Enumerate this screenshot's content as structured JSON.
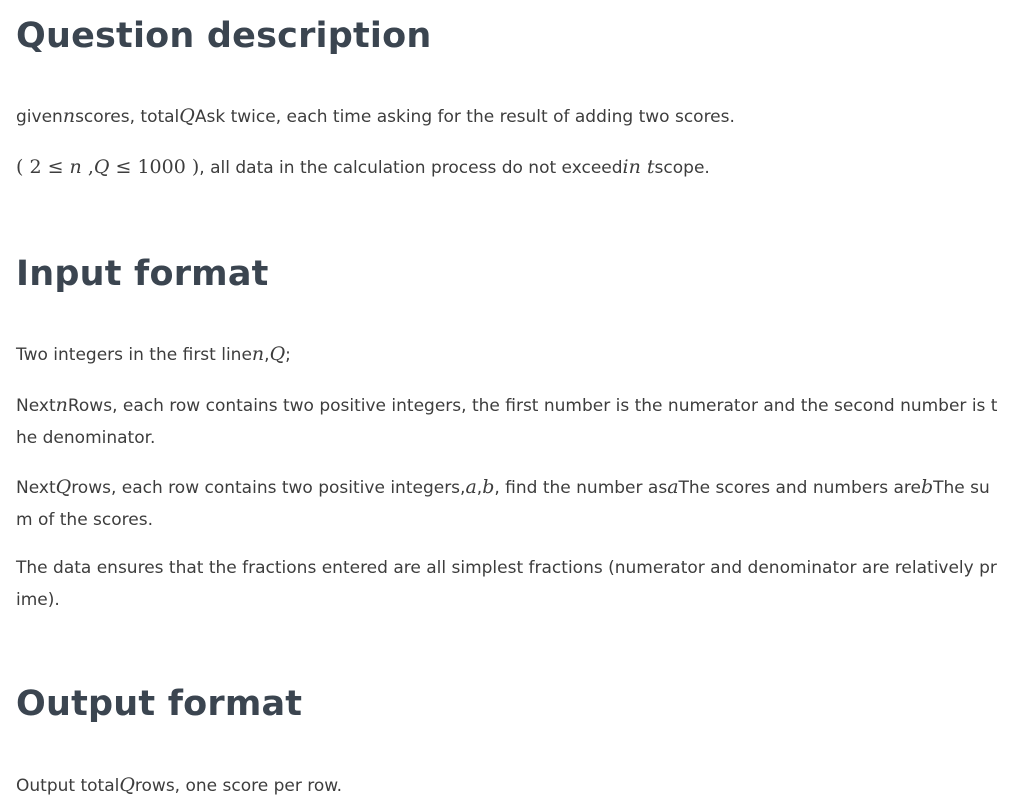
{
  "sections": {
    "description": {
      "heading": "Question description",
      "p1": {
        "t1": "given",
        "v_n": "n",
        "t2": "scores, total",
        "v_Q": "Q",
        "t3": "Ask twice, each time asking for the result of adding two scores."
      },
      "p2": {
        "open": "( ",
        "c2": "2",
        "le1": " ≤ ",
        "v_n": "n",
        "comma": " ,",
        "v_Q": "Q",
        "le2": " ≤ ",
        "c1000": "1000",
        "close": " )",
        "t1": ", all data in the calculation process do not exceed",
        "v_in": "in",
        "v_t": " t",
        "t2": "scope."
      }
    },
    "input": {
      "heading": "Input format",
      "p1": {
        "t1": "Two integers in the first line",
        "v_n": "n",
        "sep": ",",
        "v_Q": "Q",
        "t2": ";"
      },
      "p2": {
        "t1": "Next",
        "v_n": "n",
        "t2": "Rows, each row contains two positive integers, the first number is the numerator and the second number is the denominator."
      },
      "p3": {
        "t1": "Next",
        "v_Q": "Q",
        "t2": "rows, each row contains two positive integers,",
        "v_a": "a",
        "sep": ",",
        "v_b": "b",
        "t3": ", find the number as",
        "v_a2": "a",
        "t4": "The scores and numbers are",
        "v_b2": "b",
        "t5": "The sum of the scores."
      },
      "p4": {
        "t1": "The data ensures that the fractions entered are all simplest fractions (numerator and denominator are relatively prime)."
      }
    },
    "output": {
      "heading": "Output format",
      "p1": {
        "t1": "Output total",
        "v_Q": "Q",
        "t2": "rows, one score per row."
      }
    }
  }
}
